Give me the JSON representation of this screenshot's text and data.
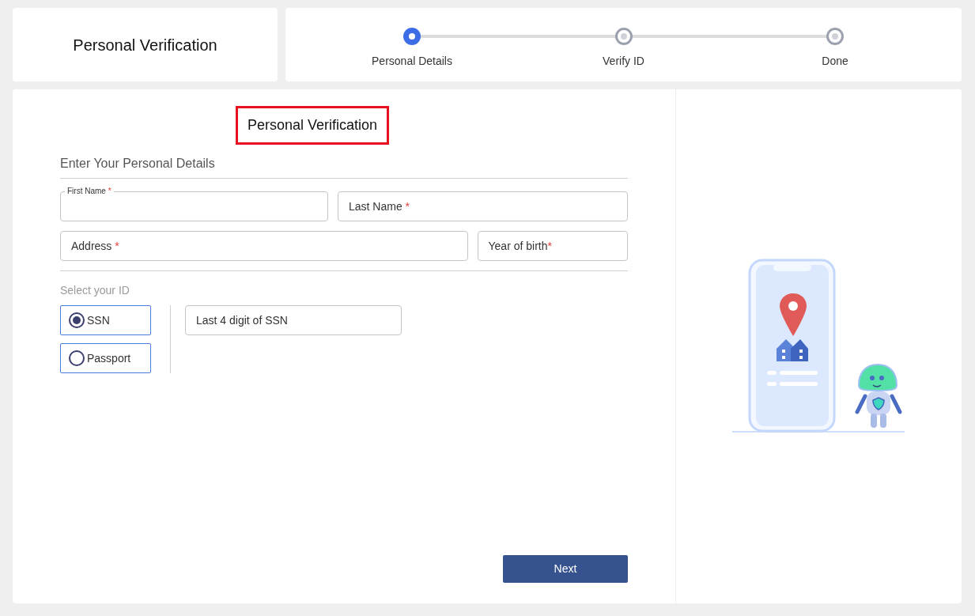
{
  "header": {
    "title": "Personal Verification"
  },
  "stepper": [
    {
      "label": "Personal Details",
      "selected": true
    },
    {
      "label": "Verify ID",
      "selected": false
    },
    {
      "label": "Done",
      "selected": false
    }
  ],
  "form": {
    "title": "Personal Verification",
    "title_highlighted": true,
    "section": "Enter Your Personal Details",
    "rows": [
      [
        {
          "label": "First Name",
          "mark": "*",
          "floating": true
        },
        {
          "label": "Last Name",
          "mark": "*",
          "floating": false
        }
      ],
      [
        {
          "label": "Address",
          "mark": "*",
          "floating": false
        },
        {
          "label": "Year of birth",
          "mark": "*",
          "floating": false
        }
      ]
    ],
    "id_label": "Select your ID",
    "id_options": [
      {
        "label": "SSN",
        "selected": true
      },
      {
        "label": "Passport",
        "selected": false
      }
    ],
    "id_field": {
      "placeholder": "Last 4 digit of SSN"
    },
    "next_button": "Next"
  }
}
